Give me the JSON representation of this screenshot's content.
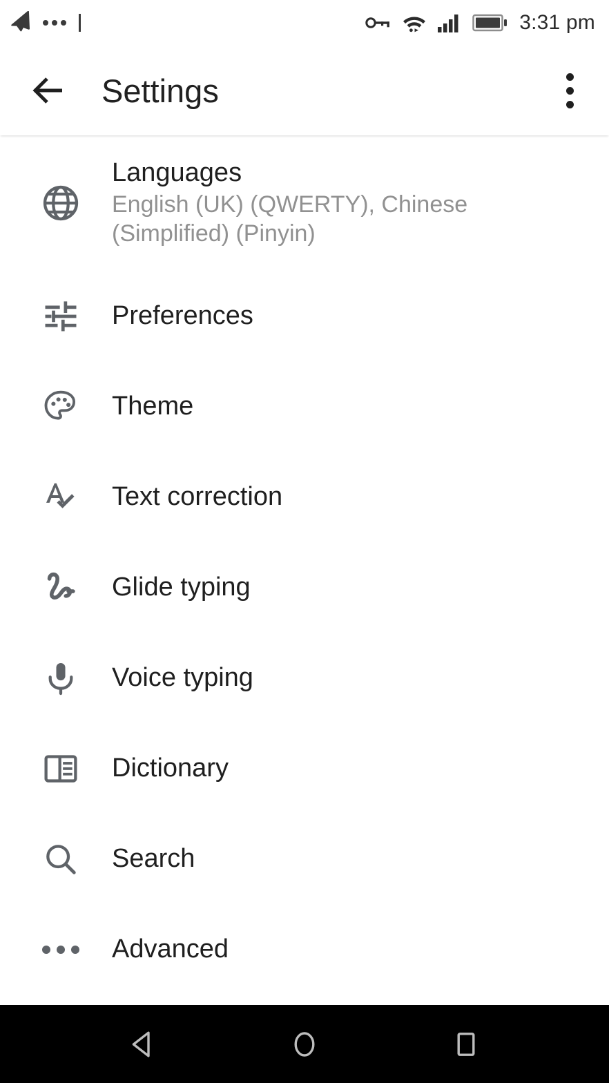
{
  "status_bar": {
    "left_icons": [
      {
        "name": "telegram-paper-plane-icon",
        "glyph": "send"
      },
      {
        "name": "notification-dots-icon",
        "glyph": "dots"
      }
    ],
    "right_icons": [
      {
        "name": "vpn-key-icon",
        "glyph": "key"
      },
      {
        "name": "wifi-icon",
        "glyph": "wifi"
      },
      {
        "name": "cellular-signal-icon",
        "glyph": "signal"
      },
      {
        "name": "battery-icon",
        "glyph": "battery"
      }
    ],
    "clock": "3:31 pm"
  },
  "app_bar": {
    "back_label": "Back",
    "title": "Settings",
    "overflow_label": "More options"
  },
  "settings": {
    "items": [
      {
        "icon": "globe-icon",
        "title": "Languages",
        "subtitle": "English (UK) (QWERTY), Chinese (Simplified) (Pinyin)"
      },
      {
        "icon": "tune-sliders-icon",
        "title": "Preferences",
        "subtitle": ""
      },
      {
        "icon": "palette-icon",
        "title": "Theme",
        "subtitle": ""
      },
      {
        "icon": "spellcheck-icon",
        "title": "Text correction",
        "subtitle": ""
      },
      {
        "icon": "gesture-squiggle-icon",
        "title": "Glide typing",
        "subtitle": ""
      },
      {
        "icon": "microphone-icon",
        "title": "Voice typing",
        "subtitle": ""
      },
      {
        "icon": "dictionary-book-icon",
        "title": "Dictionary",
        "subtitle": ""
      },
      {
        "icon": "search-icon",
        "title": "Search",
        "subtitle": ""
      },
      {
        "icon": "more-horiz-icon",
        "title": "Advanced",
        "subtitle": ""
      }
    ]
  },
  "nav_bar": {
    "buttons": [
      {
        "name": "nav-back-button",
        "label": "Back"
      },
      {
        "name": "nav-home-button",
        "label": "Home"
      },
      {
        "name": "nav-recents-button",
        "label": "Recents"
      }
    ]
  },
  "colors": {
    "background": "#ffffff",
    "primary_text": "#1f1f1f",
    "secondary_text": "#919191",
    "icon": "#5f6368",
    "nav_bar_bg": "#000000",
    "nav_icon": "#bdbdbd"
  }
}
